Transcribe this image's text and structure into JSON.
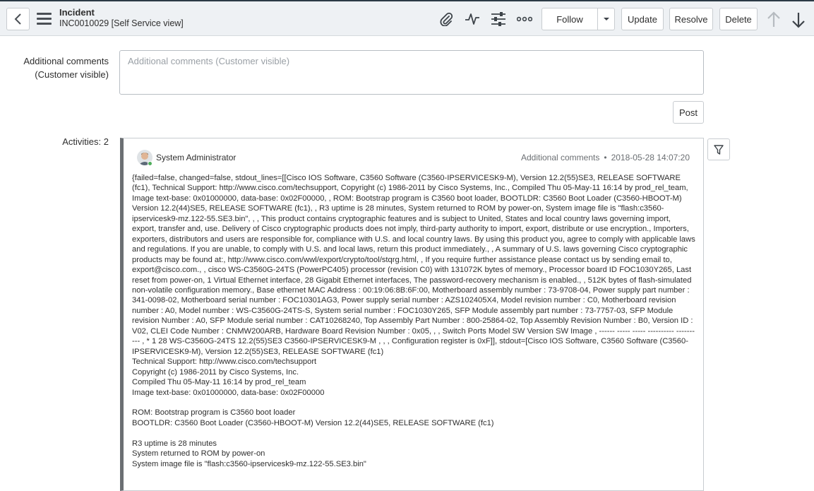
{
  "header": {
    "back_icon": "chevron-left-icon",
    "menu_icon": "hamburger-icon",
    "title": "Incident",
    "subtitle": "INC0010029 [Self Service view]",
    "icons": [
      "paperclip-icon",
      "activity-icon",
      "sliders-icon",
      "more-icon"
    ],
    "follow_label": "Follow",
    "update_label": "Update",
    "resolve_label": "Resolve",
    "delete_label": "Delete",
    "colors": {
      "header_bg": "#eef1f4",
      "topline": "#2b3a45"
    }
  },
  "comments": {
    "label_line1": "Additional comments",
    "label_line2": "(Customer visible)",
    "placeholder": "Additional comments (Customer visible)",
    "post_label": "Post"
  },
  "activities": {
    "label": "Activities: 2",
    "entry": {
      "author": "System Administrator",
      "type": "Additional comments",
      "separator": "•",
      "timestamp": "2018-05-28 14:07:20",
      "body": "{failed=false, changed=false, stdout_lines=[[Cisco IOS Software, C3560 Software (C3560-IPSERVICESK9-M), Version 12.2(55)SE3, RELEASE SOFTWARE (fc1), Technical Support: http://www.cisco.com/techsupport, Copyright (c) 1986-2011 by Cisco Systems, Inc., Compiled Thu 05-May-11 16:14 by prod_rel_team, Image text-base: 0x01000000, data-base: 0x02F00000, , ROM: Bootstrap program is C3560 boot loader, BOOTLDR: C3560 Boot Loader (C3560-HBOOT-M) Version 12.2(44)SE5, RELEASE SOFTWARE (fc1), , R3 uptime is 28 minutes, System returned to ROM by power-on, System image file is \"flash:c3560-ipservicesk9-mz.122-55.SE3.bin\", , , This product contains cryptographic features and is subject to United, States and local country laws governing import, export, transfer and, use. Delivery of Cisco cryptographic products does not imply, third-party authority to import, export, distribute or use encryption., Importers, exporters, distributors and users are responsible for, compliance with U.S. and local country laws. By using this product you, agree to comply with applicable laws and regulations. If you are unable, to comply with U.S. and local laws, return this product immediately., , A summary of U.S. laws governing Cisco cryptographic products may be found at:, http://www.cisco.com/wwl/export/crypto/tool/stqrg.html, , If you require further assistance please contact us by sending email to, export@cisco.com., , cisco WS-C3560G-24TS (PowerPC405) processor (revision C0) with 131072K bytes of memory., Processor board ID FOC1030Y265, Last reset from power-on, 1 Virtual Ethernet interface, 28 Gigabit Ethernet interfaces, The password-recovery mechanism is enabled., , 512K bytes of flash-simulated non-volatile configuration memory., Base ethernet MAC Address : 00:19:06:8B:6F:00, Motherboard assembly number : 73-9708-04, Power supply part number : 341-0098-02, Motherboard serial number : FOC10301AG3, Power supply serial number : AZS102405X4, Model revision number : C0, Motherboard revision number : A0, Model number : WS-C3560G-24TS-S, System serial number : FOC1030Y265, SFP Module assembly part number : 73-7757-03, SFP Module revision Number : A0, SFP Module serial number : CAT10268240, Top Assembly Part Number : 800-25864-02, Top Assembly Revision Number : B0, Version ID : V02, CLEI Code Number : CNMW200ARB, Hardware Board Revision Number : 0x05, , , Switch Ports Model SW Version SW Image , ------ ----- ----- ---------- ---------- , * 1 28 WS-C3560G-24TS 12.2(55)SE3 C3560-IPSERVICESK9-M , , , Configuration register is 0xF]], stdout=[Cisco IOS Software, C3560 Software (C3560-IPSERVICESK9-M), Version 12.2(55)SE3, RELEASE SOFTWARE (fc1)\nTechnical Support: http://www.cisco.com/techsupport\nCopyright (c) 1986-2011 by Cisco Systems, Inc.\nCompiled Thu 05-May-11 16:14 by prod_rel_team\nImage text-base: 0x01000000, data-base: 0x02F00000\n\nROM: Bootstrap program is C3560 boot loader\nBOOTLDR: C3560 Boot Loader (C3560-HBOOT-M) Version 12.2(44)SE5, RELEASE SOFTWARE (fc1)\n\nR3 uptime is 28 minutes\nSystem returned to ROM by power-on\nSystem image file is \"flash:c3560-ipservicesk9-mz.122-55.SE3.bin\""
    },
    "filter_icon": "filter-icon"
  }
}
